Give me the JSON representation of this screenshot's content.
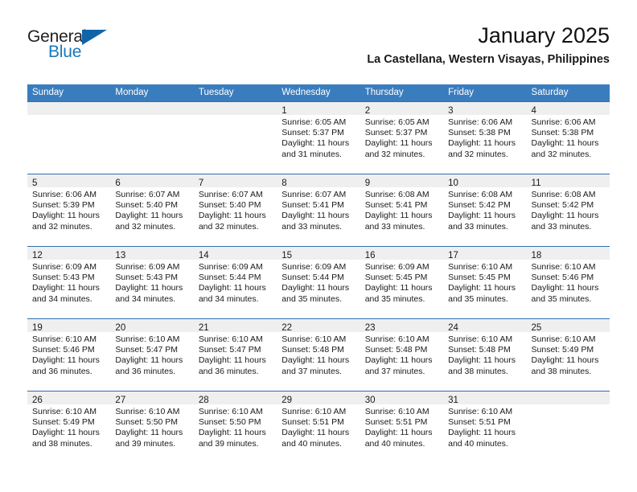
{
  "brand": {
    "word1": "General",
    "word2": "Blue",
    "triangle_color": "#1064a8",
    "blue_color": "#1878be"
  },
  "header": {
    "month_title": "January 2025",
    "location": "La Castellana, Western Visayas, Philippines"
  },
  "theme": {
    "header_blue": "#3a7dbe",
    "rule_blue": "#2f6fae",
    "daynum_strip": "#efefef"
  },
  "calendar": {
    "day_headers": [
      "Sunday",
      "Monday",
      "Tuesday",
      "Wednesday",
      "Thursday",
      "Friday",
      "Saturday"
    ],
    "weeks": [
      [
        {
          "day": "",
          "empty": true
        },
        {
          "day": "",
          "empty": true
        },
        {
          "day": "",
          "empty": true
        },
        {
          "day": "1",
          "sunrise": "Sunrise: 6:05 AM",
          "sunset": "Sunset: 5:37 PM",
          "daylight1": "Daylight: 11 hours",
          "daylight2": "and 31 minutes."
        },
        {
          "day": "2",
          "sunrise": "Sunrise: 6:05 AM",
          "sunset": "Sunset: 5:37 PM",
          "daylight1": "Daylight: 11 hours",
          "daylight2": "and 32 minutes."
        },
        {
          "day": "3",
          "sunrise": "Sunrise: 6:06 AM",
          "sunset": "Sunset: 5:38 PM",
          "daylight1": "Daylight: 11 hours",
          "daylight2": "and 32 minutes."
        },
        {
          "day": "4",
          "sunrise": "Sunrise: 6:06 AM",
          "sunset": "Sunset: 5:38 PM",
          "daylight1": "Daylight: 11 hours",
          "daylight2": "and 32 minutes."
        }
      ],
      [
        {
          "day": "5",
          "sunrise": "Sunrise: 6:06 AM",
          "sunset": "Sunset: 5:39 PM",
          "daylight1": "Daylight: 11 hours",
          "daylight2": "and 32 minutes."
        },
        {
          "day": "6",
          "sunrise": "Sunrise: 6:07 AM",
          "sunset": "Sunset: 5:40 PM",
          "daylight1": "Daylight: 11 hours",
          "daylight2": "and 32 minutes."
        },
        {
          "day": "7",
          "sunrise": "Sunrise: 6:07 AM",
          "sunset": "Sunset: 5:40 PM",
          "daylight1": "Daylight: 11 hours",
          "daylight2": "and 32 minutes."
        },
        {
          "day": "8",
          "sunrise": "Sunrise: 6:07 AM",
          "sunset": "Sunset: 5:41 PM",
          "daylight1": "Daylight: 11 hours",
          "daylight2": "and 33 minutes."
        },
        {
          "day": "9",
          "sunrise": "Sunrise: 6:08 AM",
          "sunset": "Sunset: 5:41 PM",
          "daylight1": "Daylight: 11 hours",
          "daylight2": "and 33 minutes."
        },
        {
          "day": "10",
          "sunrise": "Sunrise: 6:08 AM",
          "sunset": "Sunset: 5:42 PM",
          "daylight1": "Daylight: 11 hours",
          "daylight2": "and 33 minutes."
        },
        {
          "day": "11",
          "sunrise": "Sunrise: 6:08 AM",
          "sunset": "Sunset: 5:42 PM",
          "daylight1": "Daylight: 11 hours",
          "daylight2": "and 33 minutes."
        }
      ],
      [
        {
          "day": "12",
          "sunrise": "Sunrise: 6:09 AM",
          "sunset": "Sunset: 5:43 PM",
          "daylight1": "Daylight: 11 hours",
          "daylight2": "and 34 minutes."
        },
        {
          "day": "13",
          "sunrise": "Sunrise: 6:09 AM",
          "sunset": "Sunset: 5:43 PM",
          "daylight1": "Daylight: 11 hours",
          "daylight2": "and 34 minutes."
        },
        {
          "day": "14",
          "sunrise": "Sunrise: 6:09 AM",
          "sunset": "Sunset: 5:44 PM",
          "daylight1": "Daylight: 11 hours",
          "daylight2": "and 34 minutes."
        },
        {
          "day": "15",
          "sunrise": "Sunrise: 6:09 AM",
          "sunset": "Sunset: 5:44 PM",
          "daylight1": "Daylight: 11 hours",
          "daylight2": "and 35 minutes."
        },
        {
          "day": "16",
          "sunrise": "Sunrise: 6:09 AM",
          "sunset": "Sunset: 5:45 PM",
          "daylight1": "Daylight: 11 hours",
          "daylight2": "and 35 minutes."
        },
        {
          "day": "17",
          "sunrise": "Sunrise: 6:10 AM",
          "sunset": "Sunset: 5:45 PM",
          "daylight1": "Daylight: 11 hours",
          "daylight2": "and 35 minutes."
        },
        {
          "day": "18",
          "sunrise": "Sunrise: 6:10 AM",
          "sunset": "Sunset: 5:46 PM",
          "daylight1": "Daylight: 11 hours",
          "daylight2": "and 35 minutes."
        }
      ],
      [
        {
          "day": "19",
          "sunrise": "Sunrise: 6:10 AM",
          "sunset": "Sunset: 5:46 PM",
          "daylight1": "Daylight: 11 hours",
          "daylight2": "and 36 minutes."
        },
        {
          "day": "20",
          "sunrise": "Sunrise: 6:10 AM",
          "sunset": "Sunset: 5:47 PM",
          "daylight1": "Daylight: 11 hours",
          "daylight2": "and 36 minutes."
        },
        {
          "day": "21",
          "sunrise": "Sunrise: 6:10 AM",
          "sunset": "Sunset: 5:47 PM",
          "daylight1": "Daylight: 11 hours",
          "daylight2": "and 36 minutes."
        },
        {
          "day": "22",
          "sunrise": "Sunrise: 6:10 AM",
          "sunset": "Sunset: 5:48 PM",
          "daylight1": "Daylight: 11 hours",
          "daylight2": "and 37 minutes."
        },
        {
          "day": "23",
          "sunrise": "Sunrise: 6:10 AM",
          "sunset": "Sunset: 5:48 PM",
          "daylight1": "Daylight: 11 hours",
          "daylight2": "and 37 minutes."
        },
        {
          "day": "24",
          "sunrise": "Sunrise: 6:10 AM",
          "sunset": "Sunset: 5:48 PM",
          "daylight1": "Daylight: 11 hours",
          "daylight2": "and 38 minutes."
        },
        {
          "day": "25",
          "sunrise": "Sunrise: 6:10 AM",
          "sunset": "Sunset: 5:49 PM",
          "daylight1": "Daylight: 11 hours",
          "daylight2": "and 38 minutes."
        }
      ],
      [
        {
          "day": "26",
          "sunrise": "Sunrise: 6:10 AM",
          "sunset": "Sunset: 5:49 PM",
          "daylight1": "Daylight: 11 hours",
          "daylight2": "and 38 minutes."
        },
        {
          "day": "27",
          "sunrise": "Sunrise: 6:10 AM",
          "sunset": "Sunset: 5:50 PM",
          "daylight1": "Daylight: 11 hours",
          "daylight2": "and 39 minutes."
        },
        {
          "day": "28",
          "sunrise": "Sunrise: 6:10 AM",
          "sunset": "Sunset: 5:50 PM",
          "daylight1": "Daylight: 11 hours",
          "daylight2": "and 39 minutes."
        },
        {
          "day": "29",
          "sunrise": "Sunrise: 6:10 AM",
          "sunset": "Sunset: 5:51 PM",
          "daylight1": "Daylight: 11 hours",
          "daylight2": "and 40 minutes."
        },
        {
          "day": "30",
          "sunrise": "Sunrise: 6:10 AM",
          "sunset": "Sunset: 5:51 PM",
          "daylight1": "Daylight: 11 hours",
          "daylight2": "and 40 minutes."
        },
        {
          "day": "31",
          "sunrise": "Sunrise: 6:10 AM",
          "sunset": "Sunset: 5:51 PM",
          "daylight1": "Daylight: 11 hours",
          "daylight2": "and 40 minutes."
        },
        {
          "day": "",
          "empty": true
        }
      ]
    ]
  }
}
